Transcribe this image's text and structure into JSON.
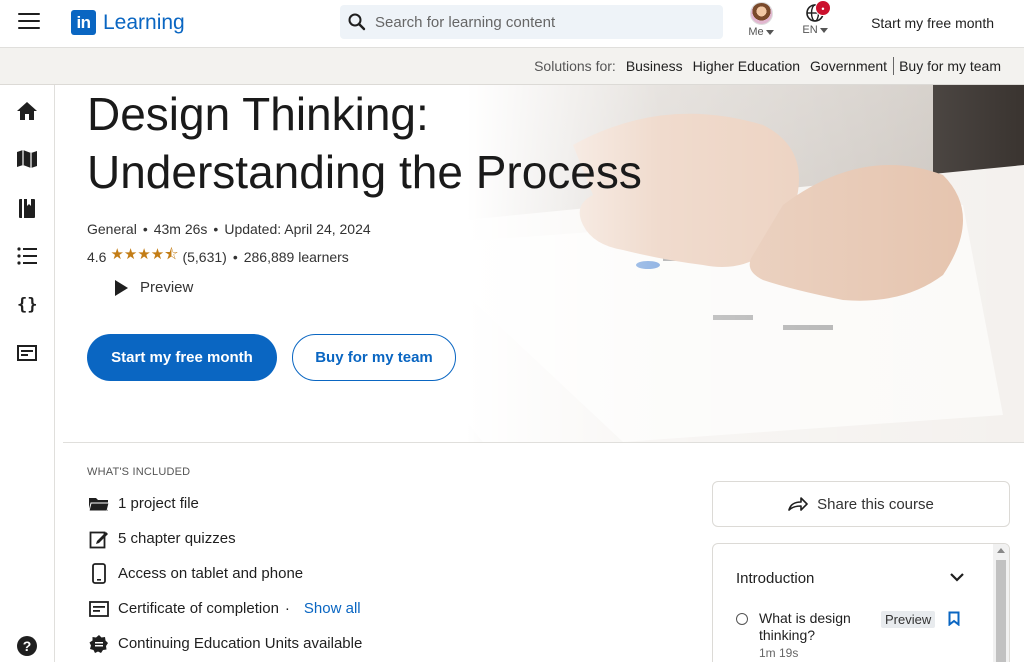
{
  "header": {
    "logo_mark": "in",
    "logo_word": "Learning",
    "search_placeholder": "Search for learning content",
    "me_label": "Me",
    "lang_label": "EN",
    "notification_count": "•",
    "cta": "Start my free month"
  },
  "solutions": {
    "label": "Solutions for:",
    "links": [
      "Business",
      "Higher Education",
      "Government"
    ],
    "buy": "Buy for my team"
  },
  "rail": {
    "items": [
      "home-icon",
      "map-icon",
      "book-icon",
      "list-icon",
      "code-icon",
      "certificate-icon"
    ],
    "help": "?"
  },
  "course": {
    "title_line1": "Design Thinking:",
    "title_line2": "Understanding the Process",
    "level": "General",
    "duration": "43m 26s",
    "updated": "Updated: April 24, 2024",
    "rating": "4.6",
    "stars": "★★★★⯪",
    "rating_count": "(5,631)",
    "learners": "286,889 learners",
    "preview": "Preview",
    "primary_cta": "Start my free month",
    "secondary_cta": "Buy for my team",
    "accent_color": "#0a66c2",
    "star_color": "#c37d16"
  },
  "included": {
    "title": "WHAT'S INCLUDED",
    "items": [
      {
        "icon": "folder-icon",
        "label": "1 project file"
      },
      {
        "icon": "quiz-icon",
        "label": "5 chapter quizzes"
      },
      {
        "icon": "phone-icon",
        "label": "Access on tablet and phone"
      },
      {
        "icon": "certificate-icon",
        "label": "Certificate of completion"
      },
      {
        "icon": "ceu-badge-icon",
        "label": "Continuing Education Units available"
      }
    ],
    "show_all": "Show all"
  },
  "share": {
    "label": "Share this course"
  },
  "toc": {
    "section": "Introduction",
    "item_name": "What is design thinking?",
    "item_duration": "1m 19s",
    "item_badge": "Preview"
  }
}
